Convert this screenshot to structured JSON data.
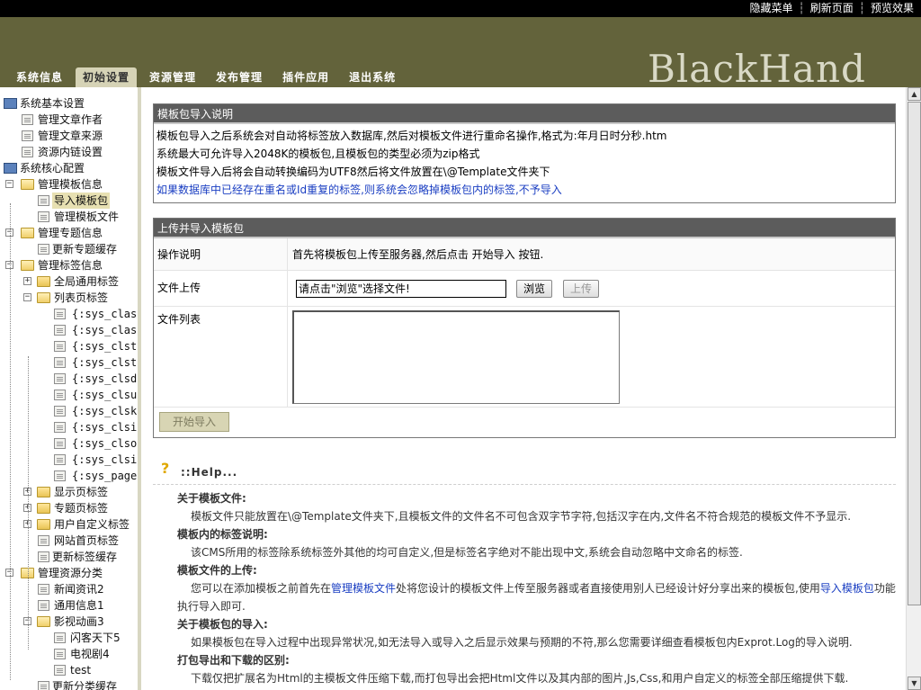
{
  "topbar": {
    "links": [
      "隐藏菜单",
      "刷新页面",
      "预览效果"
    ]
  },
  "header": {
    "logo": "BlackHand",
    "nav": [
      "系统信息",
      "初始设置",
      "资源管理",
      "发布管理",
      "插件应用",
      "退出系统"
    ],
    "active_nav": "初始设置"
  },
  "sidebar": {
    "sys_basic": "系统基本设置",
    "author": "管理文章作者",
    "source": "管理文章来源",
    "innerlink": "资源内链设置",
    "sys_core": "系统核心配置",
    "tpl_info": "管理模板信息",
    "import_tpl": "导入模板包",
    "tpl_file": "管理模板文件",
    "topic_info": "管理专题信息",
    "topic_cache": "更新专题缓存",
    "label_info": "管理标签信息",
    "global_label": "全局通用标签",
    "list_label": "列表页标签",
    "list_items": [
      "{:sys_classp",
      "{:sys_classp",
      "{:sys_clstitle",
      "{:sys_clstitle",
      "{:sys_clsdire",
      "{:sys_clsurl:",
      "{:sys_clskey",
      "{:sys_clsinfc",
      "{:sys_clsorc",
      "{:sys_clsid:}",
      "{:sys_pagel"
    ],
    "show_label": "显示页标签",
    "topic_label": "专题页标签",
    "custom_label": "用户自定义标签",
    "home_label": "网站首页标签",
    "label_cache": "更新标签缓存",
    "res_class": "管理资源分类",
    "news": "新闻资讯2",
    "general": "通用信息1",
    "video": "影视动画3",
    "flash": "闪客天下5",
    "tv": "电视剧4",
    "test": "test",
    "class_cache": "更新分类缓存"
  },
  "intro_box": {
    "title": "模板包导入说明",
    "lines": [
      "模板包导入之后系统会对自动将标签放入数据库,然后对模板文件进行重命名操作,格式为:年月日时分秒.htm",
      "系统最大可允许导入2048K的模板包,且模板包的类型必须为zip格式",
      "模板文件导入后将会自动转换编码为UTF8然后将文件放置在\\@Template文件夹下"
    ],
    "warning": "如果数据库中已经存在重名或Id重复的标签,则系统会忽略掉模板包内的标签,不予导入"
  },
  "upload_box": {
    "title": "上传并导入模板包",
    "op_label": "操作说明",
    "op_value": "首先将模板包上传至服务器,然后点击  开始导入  按钮.",
    "file_label": "文件上传",
    "file_value": "请点击\"浏览\"选择文件!",
    "browse": "浏览",
    "upload": "上传",
    "list_label": "文件列表",
    "start": "开始导入"
  },
  "help": {
    "icon": "?",
    "title": "::Help...",
    "s1_title": "关于模板文件:",
    "s1_text": "模板文件只能放置在\\@Template文件夹下,且模板文件的文件名不可包含双字节字符,包括汉字在内,文件名不符合规范的模板文件不予显示.",
    "s2_title": "模板内的标签说明:",
    "s2_text": "该CMS所用的标签除系统标签外其他的均可自定义,但是标签名字绝对不能出现中文,系统会自动忽略中文命名的标签.",
    "s3_title": "模板文件的上传:",
    "s3_pre": "您可以在添加模板之前首先在",
    "s3_link1": "管理模板文件",
    "s3_mid": "处将您设计的模板文件上传至服务器或者直接使用别人已经设计好分享出来的模板包,使用",
    "s3_link2": "导入模板包",
    "s3_post": "功能执行导入即可.",
    "s4_title": "关于模板包的导入:",
    "s4_text": "如果模板包在导入过程中出现异常状况,如无法导入或导入之后显示效果与预期的不符,那么您需要详细查看模板包内Exprot.Log的导入说明.",
    "s5_title": "打包导出和下载的区别:",
    "s5_text": "下载仅把扩展名为Html的主模板文件压缩下载,而打包导出会把Html文件以及其内部的图片,Js,Css,和用户自定义的标签全部压缩提供下载."
  }
}
